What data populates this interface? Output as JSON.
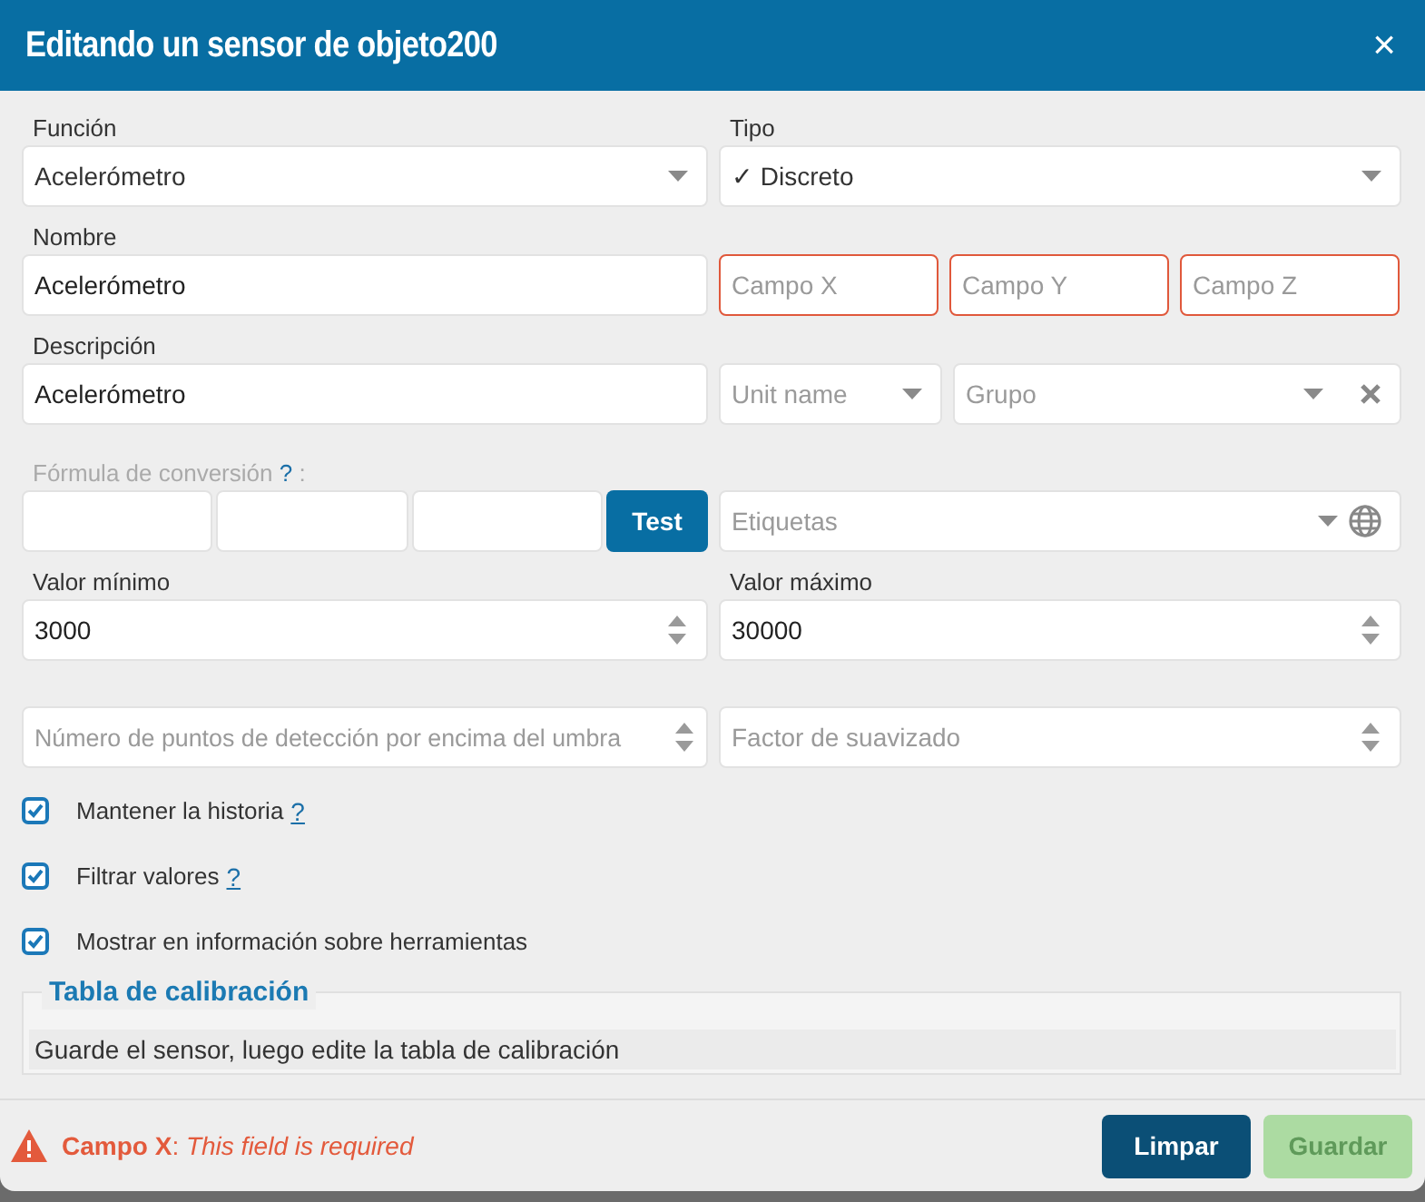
{
  "dialog": {
    "title": "Editando un sensor de objeto200",
    "close": "×"
  },
  "funcion": {
    "label": "Función",
    "value": "Acelerómetro"
  },
  "tipo": {
    "label": "Tipo",
    "value": "✓ Discreto"
  },
  "nombre": {
    "label": "Nombre",
    "value": "Acelerómetro"
  },
  "campos": [
    {
      "placeholder": "Campo X",
      "invalid": true
    },
    {
      "placeholder": "Campo Y",
      "invalid": true
    },
    {
      "placeholder": "Campo Z",
      "invalid": true
    }
  ],
  "descripcion": {
    "label": "Descripción",
    "value": "Acelerómetro"
  },
  "unit": {
    "placeholder": "Unit name"
  },
  "grupo": {
    "placeholder": "Grupo"
  },
  "formula": {
    "label": "Fórmula de conversión",
    "help": "?",
    "suffix": " :",
    "disabled": true
  },
  "test_button": {
    "label": "Test"
  },
  "etiquetas": {
    "placeholder": "Etiquetas"
  },
  "valor_minimo": {
    "label": "Valor mínimo",
    "value": "3000"
  },
  "valor_maximo": {
    "label": "Valor máximo",
    "value": "30000"
  },
  "puntos": {
    "placeholder": "Número de puntos de detección por encima del umbra"
  },
  "factor": {
    "placeholder": "Factor de suavizado"
  },
  "checkboxes": [
    {
      "label": "Mantener la historia",
      "help": "?",
      "checked": true
    },
    {
      "label": "Filtrar valores",
      "help": "?",
      "checked": true
    },
    {
      "label": "Mostrar en información sobre herramientas",
      "checked": true
    }
  ],
  "calibration": {
    "title": "Tabla de calibración",
    "message": "Guarde el sensor, luego edite la tabla de calibración"
  },
  "footer": {
    "error": "**Campo X**: *This field is required*",
    "buttons": [
      {
        "label": "Limpar",
        "kind": "primary",
        "disabled": false
      },
      {
        "label": "Guardar",
        "kind": "success",
        "disabled": true
      }
    ]
  }
}
